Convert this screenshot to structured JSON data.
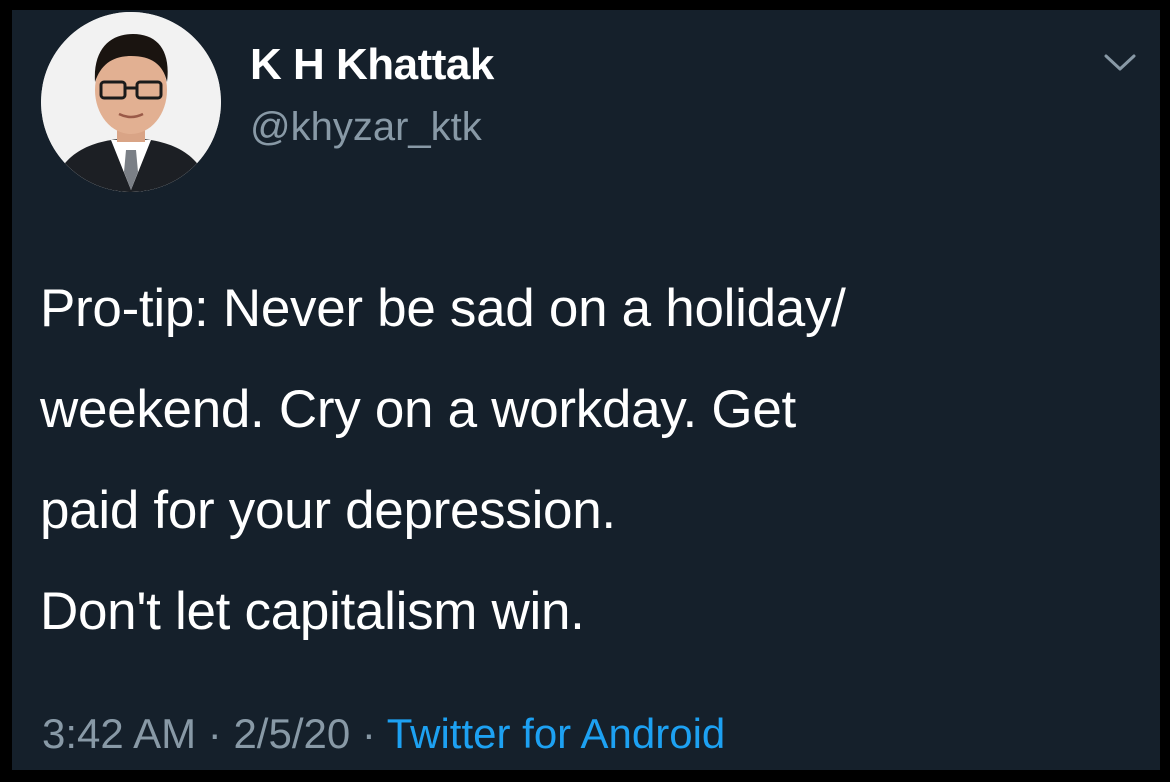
{
  "tweet": {
    "display_name": "K H Khattak",
    "handle": "@khyzar_ktk",
    "text_lines": [
      "Pro-tip: Never be sad on a holiday/",
      "weekend. Cry on a workday. Get",
      "paid for your depression.",
      "Don't let capitalism win."
    ],
    "time": "3:42 AM",
    "separator": " · ",
    "date": "2/5/20",
    "source": "Twitter for Android"
  },
  "icons": {
    "menu": "chevron-down-icon",
    "avatar": "avatar"
  },
  "colors": {
    "background": "#15202b",
    "frame": "#000000",
    "primary_text": "#ffffff",
    "secondary_text": "#8899a6",
    "link": "#1da1f2"
  }
}
